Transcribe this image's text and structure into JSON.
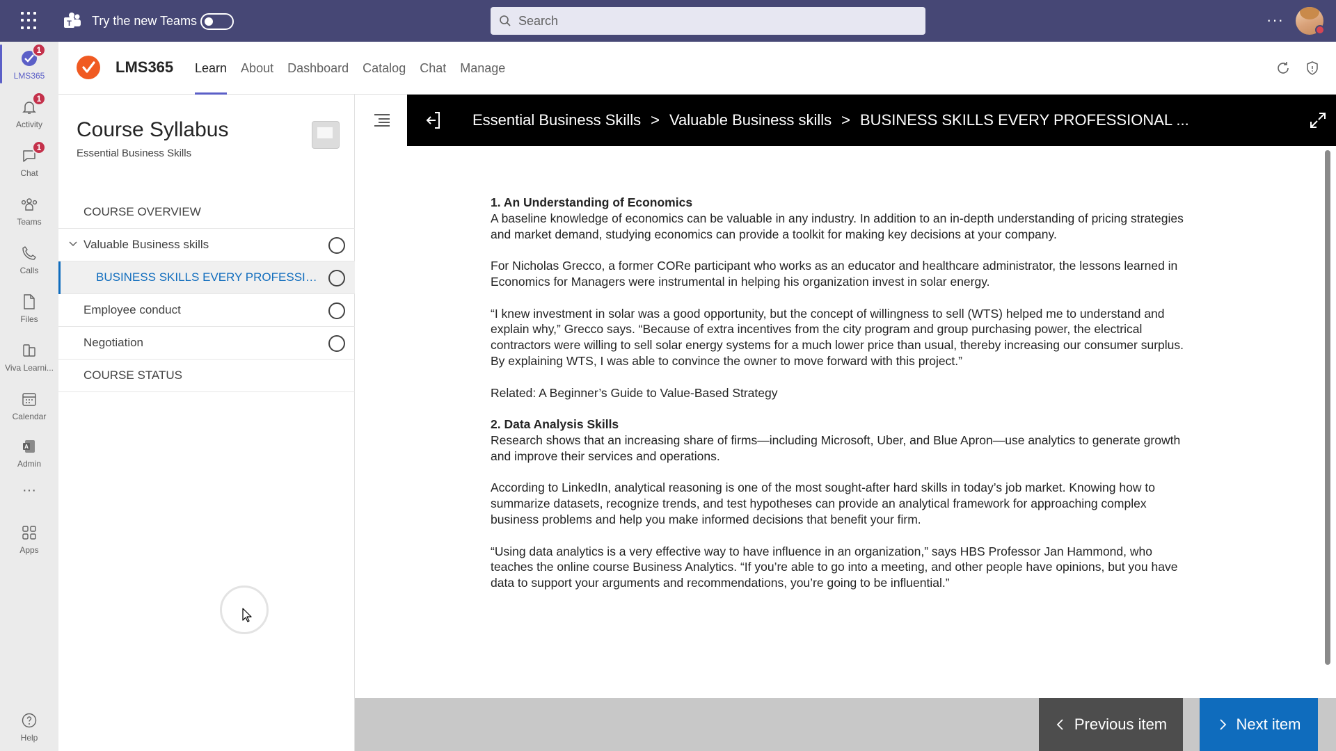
{
  "topbar": {
    "try_label": "Try the new Teams",
    "search_placeholder": "Search",
    "more": "···"
  },
  "rail": [
    {
      "label": "LMS365",
      "badge": "1",
      "icon": "lms365-check-icon"
    },
    {
      "label": "Activity",
      "badge": "1",
      "icon": "bell-icon"
    },
    {
      "label": "Chat",
      "badge": "1",
      "icon": "chat-icon"
    },
    {
      "label": "Teams",
      "icon": "teams-icon"
    },
    {
      "label": "Calls",
      "icon": "phone-icon"
    },
    {
      "label": "Files",
      "icon": "file-icon"
    },
    {
      "label": "Viva Learni...",
      "icon": "viva-learning-icon"
    },
    {
      "label": "Calendar",
      "icon": "calendar-icon"
    },
    {
      "label": "Admin",
      "icon": "admin-icon"
    },
    {
      "label": "···",
      "icon": "more-icon"
    },
    {
      "label": "Apps",
      "icon": "apps-icon"
    },
    {
      "label": "Help",
      "icon": "help-icon"
    }
  ],
  "app": {
    "name": "LMS365",
    "tabs": [
      "Learn",
      "About",
      "Dashboard",
      "Catalog",
      "Chat",
      "Manage"
    ],
    "active_tab": "Learn"
  },
  "syllabus": {
    "title": "Course Syllabus",
    "subtitle": "Essential Business Skills",
    "overview": "COURSE OVERVIEW",
    "module": "Valuable Business skills",
    "selected_item": "BUSINESS SKILLS EVERY PROFESSIONAL ...",
    "items": [
      "Employee conduct",
      "Negotiation"
    ],
    "status": "COURSE STATUS"
  },
  "breadcrumb": {
    "items": [
      "Essential Business Skills",
      "Valuable Business skills",
      "BUSINESS SKILLS EVERY PROFESSIONAL ..."
    ],
    "separator": ">"
  },
  "article": {
    "h1": "1. An Understanding of Economics",
    "p1": "A baseline knowledge of economics can be valuable in any industry. In addition to an in-depth understanding of pricing strategies and market demand, studying economics can provide a toolkit for making key decisions at your company.",
    "p2": "For Nicholas Grecco, a former CORe participant who works as an educator and healthcare administrator, the lessons learned in Economics for Managers were instrumental in helping his organization invest in solar energy.",
    "p3": "“I knew investment in solar was a good opportunity, but the concept of willingness to sell (WTS) helped me to understand and explain why,” Grecco says. “Because of extra incentives from the city program and group purchasing power, the electrical contractors were willing to sell solar energy systems for a much lower price than usual, thereby increasing our consumer surplus. By explaining WTS, I was able to convince the owner to move forward with this project.”",
    "p4": "Related: A Beginner’s Guide to Value-Based Strategy",
    "h2": "2. Data Analysis Skills",
    "p5": "Research shows that an increasing share of firms—including Microsoft, Uber, and Blue Apron—use analytics to generate growth and improve their services and operations.",
    "p6": "According to LinkedIn, analytical reasoning is one of the most sought-after hard skills in today’s job market. Knowing how to summarize datasets, recognize trends, and test hypotheses can provide an analytical framework for approaching complex business problems and help you make informed decisions that benefit your firm.",
    "p7": "“Using data analytics is a very effective way to have influence in an organization,” says HBS Professor Jan Hammond, who teaches the online course Business Analytics. “If you’re able to go into a meeting, and other people have opinions, but you have data to support your arguments and recommendations, you’re going to be influential.”"
  },
  "footer": {
    "previous": "Previous item",
    "next": "Next item"
  },
  "colors": {
    "topbar": "#464775",
    "accent": "#5b5fc7",
    "brand_orange": "#f05a22",
    "next_button": "#0f6cbd",
    "prev_button": "#4d4d4d"
  }
}
